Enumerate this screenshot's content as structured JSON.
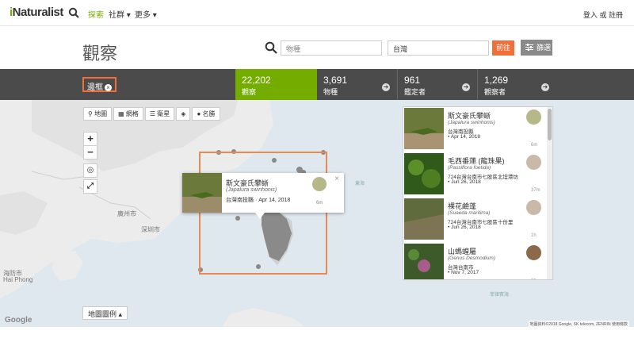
{
  "nav": {
    "logo_prefix": "i",
    "logo_rest": "Naturalist",
    "explore": "探索",
    "community": "社群",
    "more": "更多",
    "login": "登入",
    "or": "或",
    "signup": "註冊"
  },
  "header": {
    "title": "觀察",
    "species_placeholder": "物種",
    "place_value": "台灣",
    "go_label": "前往",
    "filter_label": "篩選"
  },
  "stats": {
    "boundary_label": "邊框",
    "observations": {
      "count": "22,202",
      "label": "觀察"
    },
    "species": {
      "count": "3,691",
      "label": "物種"
    },
    "identifiers": {
      "count": "961",
      "label": "鑑定者"
    },
    "observers": {
      "count": "1,269",
      "label": "觀察者"
    }
  },
  "map_tools": {
    "map": "地圖",
    "grid": "網格",
    "satellite": "衛星",
    "layers_icon": "layers-icon",
    "places": "名勝",
    "zoom_in": "+",
    "zoom_out": "−",
    "legend": "地圖圖例"
  },
  "map_labels": {
    "guangzhou": "廣州市",
    "shenzhen": "深圳市",
    "haifang": "海防市",
    "haiphong": "Hai Phong",
    "east_china_sea": "東海",
    "philippine_sea": "菲律賓海",
    "google": "Google",
    "attribution": "地圖資料©2018 Google, SK telecom, ZENRIN  使用條款"
  },
  "popup": {
    "name": "斯文豪氏攀蜥",
    "sci": "(Japalura swinhonis)",
    "place": "台灣南投縣",
    "date": "Apr 14, 2018",
    "ago": "6m",
    "close": "×"
  },
  "observations": [
    {
      "name": "斯文豪氏攀蜥",
      "sci": "(Japalura swinhonis)",
      "place": "台灣南投縣",
      "date": "Apr 14, 2018",
      "ago": "6m"
    },
    {
      "name": "毛西番蓮 (龍珠果)",
      "sci": "(Passiflora foetida)",
      "place": "724台灣台南市七股區北埕港坊",
      "date": "Jun 26, 2018",
      "ago": "37m"
    },
    {
      "name": "裸花鹼蓬",
      "sci": "(Suaeda maritima)",
      "place": "724台灣台南市七股區十份里",
      "date": "Jun 26, 2018",
      "ago": "1h"
    },
    {
      "name": "山螞蝗屬",
      "sci": "(Genus Desmodium)",
      "place": "台灣台南市",
      "date": "Nov 7, 2017",
      "ago": "1h"
    }
  ],
  "colors": {
    "accent_green": "#74ac00",
    "accent_orange": "#f16f3a",
    "stats_bg": "#4b4b4b"
  }
}
